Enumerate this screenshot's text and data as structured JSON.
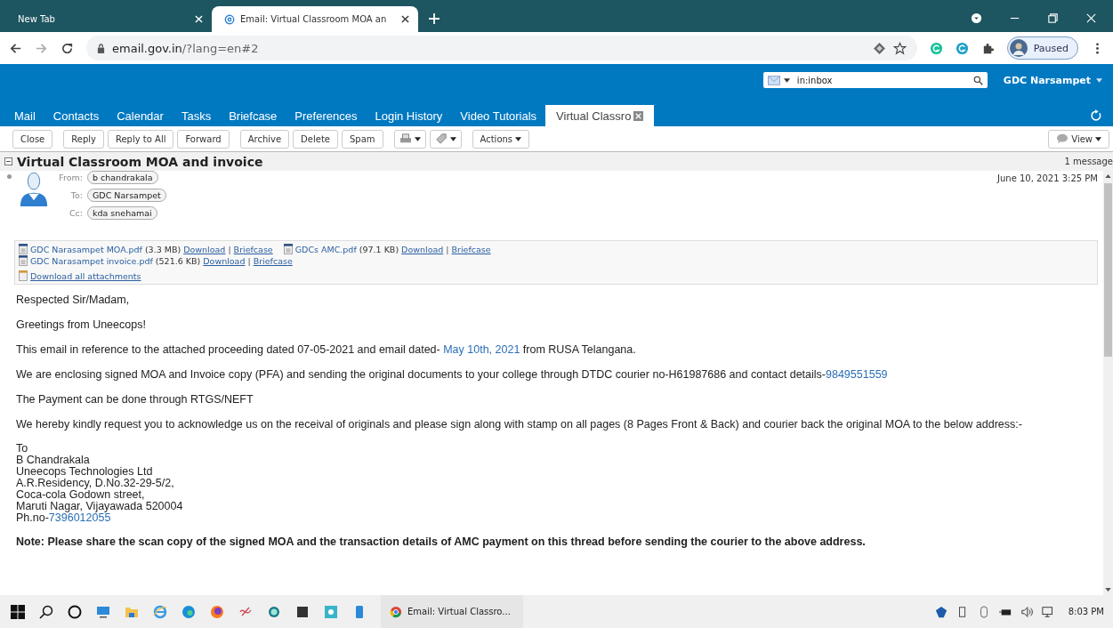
{
  "browser": {
    "tabs": [
      {
        "title": "New Tab",
        "selected": false
      },
      {
        "title": "Email: Virtual Classroom MOA an",
        "selected": true
      }
    ],
    "url_host": "email.gov.in",
    "url_path": "/?lang=en#2",
    "profile_status": "Paused"
  },
  "app": {
    "search": {
      "value": "in:inbox"
    },
    "account": "GDC Narsampet",
    "nav": [
      {
        "label": "Mail",
        "selected": false
      },
      {
        "label": "Contacts",
        "selected": false
      },
      {
        "label": "Calendar",
        "selected": false
      },
      {
        "label": "Tasks",
        "selected": false
      },
      {
        "label": "Briefcase",
        "selected": false
      },
      {
        "label": "Preferences",
        "selected": false
      },
      {
        "label": "Login History",
        "selected": false
      },
      {
        "label": "Video Tutorials",
        "selected": false
      },
      {
        "label": "Virtual Classro",
        "selected": true
      }
    ],
    "toolbar": [
      [
        {
          "kind": "text",
          "label": "Close"
        }
      ],
      [
        {
          "kind": "text",
          "label": "Reply"
        },
        {
          "kind": "text",
          "label": "Reply to All"
        },
        {
          "kind": "text",
          "label": "Forward"
        }
      ],
      [
        {
          "kind": "text",
          "label": "Archive"
        },
        {
          "kind": "text",
          "label": "Delete"
        },
        {
          "kind": "text",
          "label": "Spam"
        }
      ],
      [
        {
          "kind": "print"
        },
        {
          "kind": "tag"
        }
      ],
      [
        {
          "kind": "menu",
          "label": "Actions"
        }
      ]
    ],
    "view_label": "View"
  },
  "message": {
    "subject": "Virtual Classroom MOA and invoice",
    "count": "1 message",
    "date": "June 10, 2021 3:25 PM",
    "from": {
      "label": "From:",
      "name": "b chandrakala"
    },
    "to": {
      "label": "To:",
      "name": "GDC Narsampet"
    },
    "cc": {
      "label": "Cc:",
      "name": "kda snehamai"
    },
    "attachment_rows": [
      [
        {
          "name": "GDC Narasampet MOA.pdf",
          "size": "(3.3 MB)",
          "download": "Download",
          "separator": "|",
          "briefcase": "Briefcase"
        },
        {
          "name": "GDCs AMC.pdf",
          "size": "(97.1 KB)",
          "download": "Download",
          "separator": "|",
          "briefcase": "Briefcase"
        }
      ],
      [
        {
          "name": "GDC Narasampet invoice.pdf",
          "size": "(521.6 KB)",
          "download": "Download",
          "separator": "|",
          "briefcase": "Briefcase"
        }
      ]
    ],
    "download_all": "Download all attachments",
    "body": [
      {
        "kind": "para",
        "parts": [
          {
            "kind": "text",
            "text": "Respected Sir/Madam,"
          }
        ]
      },
      {
        "kind": "para",
        "parts": [
          {
            "kind": "text",
            "text": "Greetings from Uneecops!"
          }
        ]
      },
      {
        "kind": "para",
        "parts": [
          {
            "kind": "text",
            "text": "This email in reference to the attached proceeding dated 07-05-2021 and email dated- "
          },
          {
            "kind": "link",
            "text": "May 10th, 2021"
          },
          {
            "kind": "text",
            "text": " from RUSA Telangana."
          }
        ]
      },
      {
        "kind": "para",
        "parts": [
          {
            "kind": "text",
            "text": "We are enclosing signed MOA and Invoice copy (PFA) and sending the original documents to your college through DTDC courier no-H61987686 and contact details-"
          },
          {
            "kind": "link",
            "text": "9849551559"
          }
        ]
      },
      {
        "kind": "para",
        "parts": [
          {
            "kind": "text",
            "text": "The Payment can be done through RTGS/NEFT"
          }
        ]
      },
      {
        "kind": "para",
        "parts": [
          {
            "kind": "text",
            "text": "We hereby kindly request you to acknowledge us on the receival of originals and please sign along with stamp on all pages (8 Pages Front & Back) and courier back the original MOA to the below address:-"
          }
        ]
      },
      {
        "kind": "address",
        "lines": [
          [
            {
              "kind": "text",
              "text": "To"
            }
          ],
          [
            {
              "kind": "text",
              "text": "B Chandrakala"
            }
          ],
          [
            {
              "kind": "text",
              "text": "Uneecops Technologies Ltd"
            }
          ],
          [
            {
              "kind": "text",
              "text": "A.R.Residency, D.No.32-29-5/2,"
            }
          ],
          [
            {
              "kind": "text",
              "text": "Coca-cola Godown street,"
            }
          ],
          [
            {
              "kind": "text",
              "text": "Maruti Nagar, Vijayawada 520004"
            }
          ],
          [
            {
              "kind": "text",
              "text": "Ph.no-"
            },
            {
              "kind": "link",
              "text": "7396012055"
            }
          ]
        ]
      },
      {
        "kind": "note",
        "parts": [
          {
            "kind": "text",
            "text": "Note: Please share the scan copy of the signed MOA and the transaction details of AMC payment on this thread before sending the courier to the above address."
          }
        ]
      }
    ]
  },
  "taskbar": {
    "window_title": "Email: Virtual Classro...",
    "time": "8:03 PM"
  }
}
